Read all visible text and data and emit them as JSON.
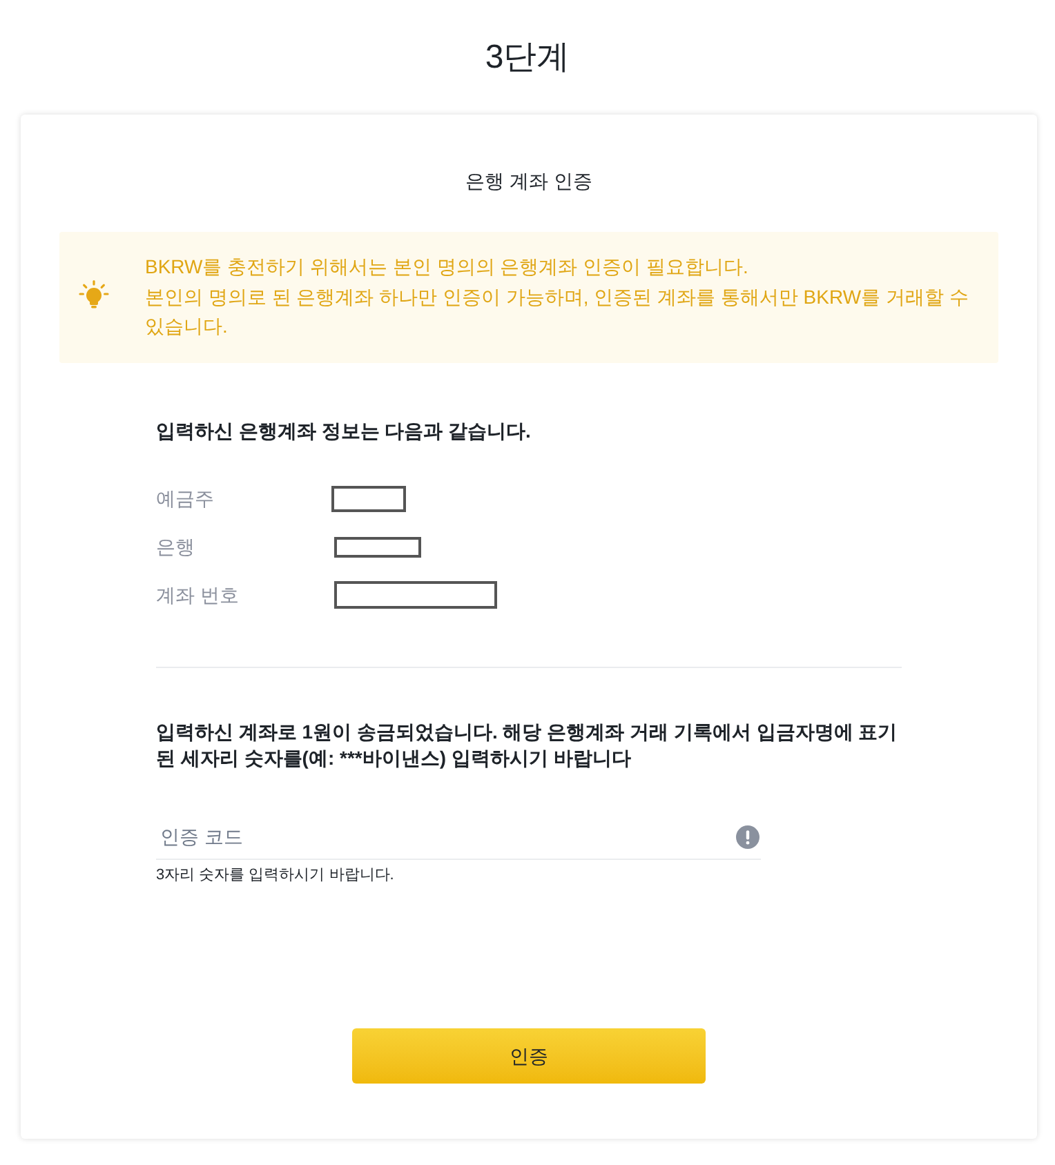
{
  "page_title": "3단계",
  "card": {
    "title": "은행 계좌 인증",
    "notice": {
      "lines": [
        "BKRW를 충전하기 위해서는 본인 명의의 은행계좌 인증이 필요합니다.",
        "본인의 명의로 된 은행계좌 하나만 인증이 가능하며, 인증된 계좌를 통해서만 BKRW를 거래할 수 있습니다."
      ]
    },
    "account_info": {
      "heading": "입력하신 은행계좌 정보는 다음과 같습니다.",
      "rows": [
        {
          "label": "예금주"
        },
        {
          "label": "은행"
        },
        {
          "label": "계좌 번호"
        }
      ]
    },
    "verification": {
      "instruction": "입력하신 계좌로 1원이 송금되었습니다. 해당 은행계좌 거래 기록에서 입금자명에 표기된 세자리 숫자를(예: ***바이낸스) 입력하시기 바랍니다",
      "code_field": {
        "placeholder": "인증 코드"
      },
      "hint": "3자리 숫자를 입력하시기 바랍니다."
    },
    "submit_button": {
      "label": "인증"
    }
  }
}
